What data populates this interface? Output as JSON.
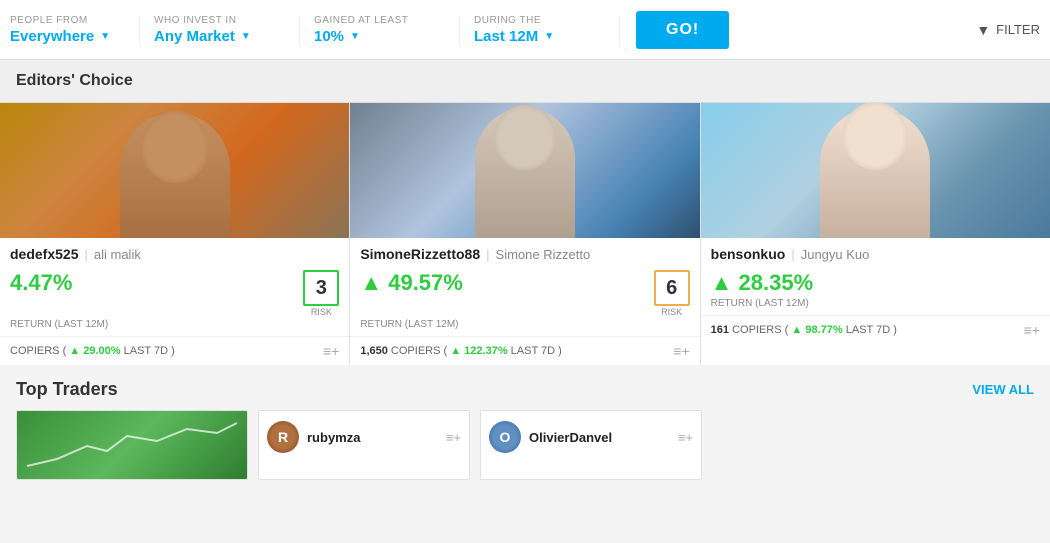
{
  "filterBar": {
    "peopleFrom": {
      "label": "PEOPLE FROM",
      "value": "Everywhere"
    },
    "whoInvestIn": {
      "label": "WHO INVEST IN",
      "value": "Any Market"
    },
    "gainedAtLeast": {
      "label": "GAINED AT LEAST",
      "value": "10%"
    },
    "duringThe": {
      "label": "DURING THE",
      "value": "Last 12M"
    },
    "goButton": "GO!",
    "filterButton": "FILTER"
  },
  "editorsChoice": {
    "sectionTitle": "Editors' Choice",
    "cards": [
      {
        "username": "dedefx525",
        "realname": "ali malik",
        "returnValue": "4.47%",
        "returnLabel": "RETURN (LAST 12M)",
        "risk": "3",
        "riskLabel": "RISK",
        "riskColor": "green",
        "copiersCount": "",
        "copiersChange": "29.00%",
        "copiersLabel": "COPIERS (",
        "copiersTrailing": " LAST 7D )"
      },
      {
        "username": "SimoneRizzetto88",
        "realname": "Simone Rizzetto",
        "returnValue": "49.57%",
        "returnLabel": "RETURN (LAST 12M)",
        "risk": "6",
        "riskLabel": "RISK",
        "riskColor": "yellow",
        "copiersCount": "1,650",
        "copiersChange": "122.37%",
        "copiersLabel": "COPIERS (",
        "copiersTrailing": " LAST 7D )"
      },
      {
        "username": "bensonkuo",
        "realname": "Jungyu Kuo",
        "returnValue": "28.35%",
        "returnLabel": "RETURN (LAST 12M)",
        "risk": "",
        "riskLabel": "",
        "riskColor": "green",
        "copiersCount": "161",
        "copiersChange": "98.77%",
        "copiersLabel": "COPIERS (",
        "copiersTrailing": " LAST 7D )"
      }
    ]
  },
  "topTraders": {
    "sectionTitle": "Top Traders",
    "viewAllLabel": "VIEW ALL",
    "miniCards": [
      {
        "username": "rubymza",
        "avatarInitial": "R",
        "avatarColor": "brown"
      },
      {
        "username": "OlivierDanvel",
        "avatarInitial": "O",
        "avatarColor": "blue"
      }
    ]
  }
}
